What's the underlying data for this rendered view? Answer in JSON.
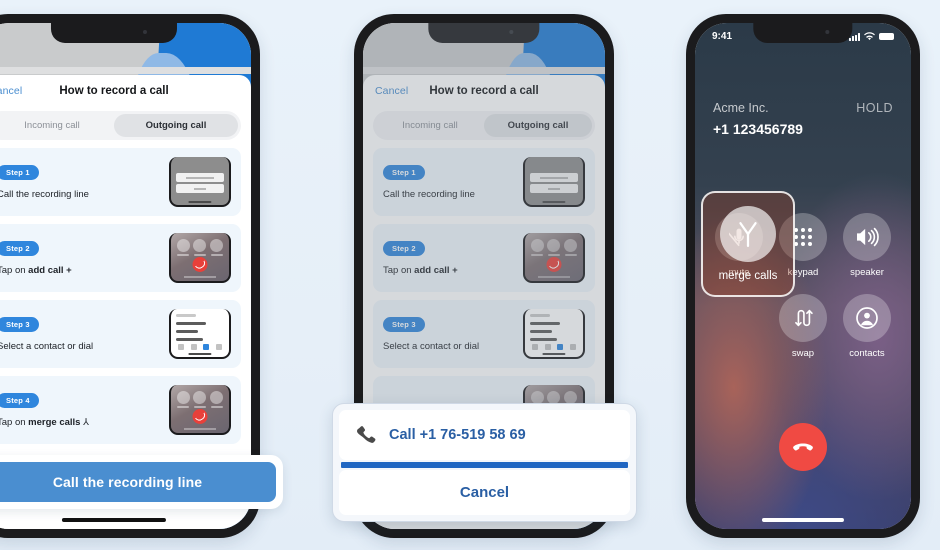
{
  "background_color": "#e8f1f9",
  "accent_blue": "#2f86dd",
  "cta_blue": "#4a8ed0",
  "phone1": {
    "sheet": {
      "cancel_label": "Cancel",
      "title": "How to record a call",
      "tabs": [
        {
          "label": "Incoming call",
          "selected": false
        },
        {
          "label": "Outgoing call",
          "selected": true
        }
      ],
      "steps": [
        {
          "badge": "Step 1",
          "text": "Call the recording line",
          "bold": "",
          "thumb": "dialog"
        },
        {
          "badge": "Step 2",
          "text": "Tap on ",
          "bold": "add call +",
          "thumb": "incall"
        },
        {
          "badge": "Step 3",
          "text": "Select a contact or dial",
          "bold": "",
          "thumb": "list"
        },
        {
          "badge": "Step 4",
          "text": "Tap on ",
          "bold": "merge calls",
          "thumb": "incall"
        }
      ]
    },
    "cta_label": "Call the recording line"
  },
  "phone2": {
    "sheet": {
      "cancel_label": "Cancel",
      "title": "How to record a call",
      "tabs": [
        {
          "label": "Incoming call",
          "selected": false
        },
        {
          "label": "Outgoing call",
          "selected": true
        }
      ],
      "steps": [
        {
          "badge": "Step 1",
          "text": "Call the recording line",
          "bold": "",
          "thumb": "dialog"
        },
        {
          "badge": "Step 2",
          "text": "Tap on ",
          "bold": "add call +",
          "thumb": "incall"
        },
        {
          "badge": "Step 3",
          "text": "Select a contact or dial",
          "bold": "",
          "thumb": "list"
        },
        {
          "badge": "Step 4",
          "text": "",
          "bold": "",
          "thumb": "incall"
        }
      ]
    },
    "dialog": {
      "call_label": "Call +1 76-519 58 69",
      "cancel_label": "Cancel",
      "icon": "phone-handset-icon"
    }
  },
  "phone3": {
    "status": {
      "time": "9:41",
      "signal_icon": "cellular-signal-icon",
      "wifi_icon": "wifi-icon",
      "battery_icon": "battery-icon"
    },
    "caller": {
      "name": "Acme Inc.",
      "state": "HOLD",
      "number": "+1 123456789"
    },
    "controls": [
      {
        "label": "mute",
        "icon": "mic-muted-icon"
      },
      {
        "label": "keypad",
        "icon": "keypad-grid-icon"
      },
      {
        "label": "speaker",
        "icon": "speaker-icon"
      },
      {
        "label": "merge calls",
        "icon": "merge-calls-icon",
        "highlighted": true
      },
      {
        "label": "swap",
        "icon": "swap-arrows-icon"
      },
      {
        "label": "contacts",
        "icon": "contacts-person-icon"
      }
    ],
    "end_call": {
      "label": "",
      "icon": "end-call-icon"
    }
  }
}
